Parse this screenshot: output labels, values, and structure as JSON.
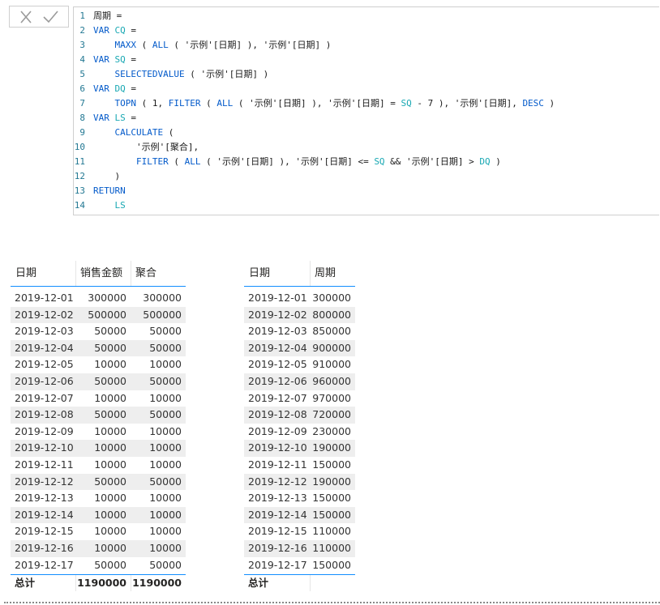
{
  "formula_bar": {
    "cancel_icon": "close-icon",
    "commit_icon": "check-icon",
    "lines": [
      {
        "n": "1",
        "parts": [
          [
            "t",
            "周期 ="
          ]
        ]
      },
      {
        "n": "2",
        "parts": [
          [
            "k",
            "VAR "
          ],
          [
            "v",
            "CQ"
          ],
          [
            "t",
            " ="
          ]
        ]
      },
      {
        "n": "3",
        "parts": [
          [
            "t",
            "    "
          ],
          [
            "k",
            "MAXX"
          ],
          [
            "t",
            " ( "
          ],
          [
            "k",
            "ALL"
          ],
          [
            "t",
            " ( '示例'[日期] ), '示例'[日期] )"
          ]
        ]
      },
      {
        "n": "4",
        "parts": [
          [
            "k",
            "VAR "
          ],
          [
            "v",
            "SQ"
          ],
          [
            "t",
            " ="
          ]
        ]
      },
      {
        "n": "5",
        "parts": [
          [
            "t",
            "    "
          ],
          [
            "k",
            "SELECTEDVALUE"
          ],
          [
            "t",
            " ( '示例'[日期] )"
          ]
        ]
      },
      {
        "n": "6",
        "parts": [
          [
            "k",
            "VAR "
          ],
          [
            "v",
            "DQ"
          ],
          [
            "t",
            " ="
          ]
        ]
      },
      {
        "n": "7",
        "parts": [
          [
            "t",
            "    "
          ],
          [
            "k",
            "TOPN"
          ],
          [
            "t",
            " ( 1, "
          ],
          [
            "k",
            "FILTER"
          ],
          [
            "t",
            " ( "
          ],
          [
            "k",
            "ALL"
          ],
          [
            "t",
            " ( '示例'[日期] ), '示例'[日期] = "
          ],
          [
            "v",
            "SQ"
          ],
          [
            "t",
            " - 7 ), '示例'[日期], "
          ],
          [
            "k",
            "DESC"
          ],
          [
            "t",
            " )"
          ]
        ]
      },
      {
        "n": "8",
        "parts": [
          [
            "k",
            "VAR "
          ],
          [
            "v",
            "LS"
          ],
          [
            "t",
            " ="
          ]
        ]
      },
      {
        "n": "9",
        "parts": [
          [
            "t",
            "    "
          ],
          [
            "k",
            "CALCULATE"
          ],
          [
            "t",
            " ("
          ]
        ]
      },
      {
        "n": "10",
        "parts": [
          [
            "t",
            "        '示例'[聚合],"
          ]
        ]
      },
      {
        "n": "11",
        "parts": [
          [
            "t",
            "        "
          ],
          [
            "k",
            "FILTER"
          ],
          [
            "t",
            " ( "
          ],
          [
            "k",
            "ALL"
          ],
          [
            "t",
            " ( '示例'[日期] ), '示例'[日期] <= "
          ],
          [
            "v",
            "SQ"
          ],
          [
            "t",
            " && '示例'[日期] > "
          ],
          [
            "v",
            "DQ"
          ],
          [
            "t",
            " )"
          ]
        ]
      },
      {
        "n": "12",
        "parts": [
          [
            "t",
            "    )"
          ]
        ]
      },
      {
        "n": "13",
        "parts": [
          [
            "k",
            "RETURN"
          ]
        ]
      },
      {
        "n": "14",
        "parts": [
          [
            "t",
            "    "
          ],
          [
            "v",
            "LS"
          ]
        ]
      }
    ]
  },
  "table_left": {
    "headers": [
      "日期",
      "销售金额",
      "聚合"
    ],
    "rows": [
      [
        "2019-12-01",
        "300000",
        "300000"
      ],
      [
        "2019-12-02",
        "500000",
        "500000"
      ],
      [
        "2019-12-03",
        "50000",
        "50000"
      ],
      [
        "2019-12-04",
        "50000",
        "50000"
      ],
      [
        "2019-12-05",
        "10000",
        "10000"
      ],
      [
        "2019-12-06",
        "50000",
        "50000"
      ],
      [
        "2019-12-07",
        "10000",
        "10000"
      ],
      [
        "2019-12-08",
        "50000",
        "50000"
      ],
      [
        "2019-12-09",
        "10000",
        "10000"
      ],
      [
        "2019-12-10",
        "10000",
        "10000"
      ],
      [
        "2019-12-11",
        "10000",
        "10000"
      ],
      [
        "2019-12-12",
        "50000",
        "50000"
      ],
      [
        "2019-12-13",
        "10000",
        "10000"
      ],
      [
        "2019-12-14",
        "10000",
        "10000"
      ],
      [
        "2019-12-15",
        "10000",
        "10000"
      ],
      [
        "2019-12-16",
        "10000",
        "10000"
      ],
      [
        "2019-12-17",
        "50000",
        "50000"
      ]
    ],
    "total": [
      "总计",
      "1190000",
      "1190000"
    ]
  },
  "table_right": {
    "headers": [
      "日期",
      "周期"
    ],
    "rows": [
      [
        "2019-12-01",
        "300000"
      ],
      [
        "2019-12-02",
        "800000"
      ],
      [
        "2019-12-03",
        "850000"
      ],
      [
        "2019-12-04",
        "900000"
      ],
      [
        "2019-12-05",
        "910000"
      ],
      [
        "2019-12-06",
        "960000"
      ],
      [
        "2019-12-07",
        "970000"
      ],
      [
        "2019-12-08",
        "720000"
      ],
      [
        "2019-12-09",
        "230000"
      ],
      [
        "2019-12-10",
        "190000"
      ],
      [
        "2019-12-11",
        "150000"
      ],
      [
        "2019-12-12",
        "190000"
      ],
      [
        "2019-12-13",
        "150000"
      ],
      [
        "2019-12-14",
        "150000"
      ],
      [
        "2019-12-15",
        "110000"
      ],
      [
        "2019-12-16",
        "110000"
      ],
      [
        "2019-12-17",
        "150000"
      ]
    ],
    "total": [
      "总计",
      ""
    ]
  },
  "colors": {
    "keyword": "#035aca",
    "variable": "#19a8b3",
    "line_number": "#237893",
    "header_underline": "#118dff",
    "alt_row": "#eeeeee"
  }
}
